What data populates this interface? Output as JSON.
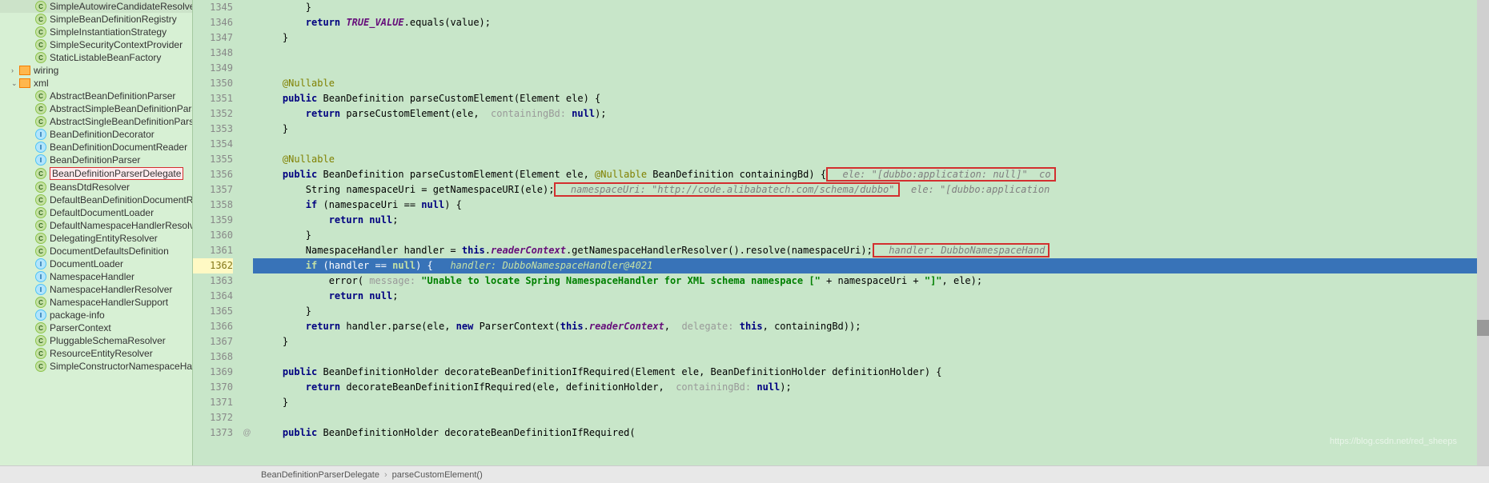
{
  "sidebar": {
    "items": [
      {
        "icon": "c",
        "label": "SimpleAutowireCandidateResolver"
      },
      {
        "icon": "c",
        "label": "SimpleBeanDefinitionRegistry"
      },
      {
        "icon": "c",
        "label": "SimpleInstantiationStrategy"
      },
      {
        "icon": "c",
        "label": "SimpleSecurityContextProvider"
      },
      {
        "icon": "c",
        "label": "StaticListableBeanFactory"
      }
    ],
    "folders": [
      {
        "expand": "›",
        "label": "wiring"
      },
      {
        "expand": "⌄",
        "label": "xml"
      }
    ],
    "xml_items": [
      {
        "icon": "c",
        "label": "AbstractBeanDefinitionParser"
      },
      {
        "icon": "c",
        "label": "AbstractSimpleBeanDefinitionParser"
      },
      {
        "icon": "c",
        "label": "AbstractSingleBeanDefinitionParser"
      },
      {
        "icon": "i",
        "label": "BeanDefinitionDecorator"
      },
      {
        "icon": "i",
        "label": "BeanDefinitionDocumentReader"
      },
      {
        "icon": "i",
        "label": "BeanDefinitionParser"
      },
      {
        "icon": "c",
        "label": "BeanDefinitionParserDelegate",
        "hl": true
      },
      {
        "icon": "c",
        "label": "BeansDtdResolver"
      },
      {
        "icon": "c",
        "label": "DefaultBeanDefinitionDocumentReade"
      },
      {
        "icon": "c",
        "label": "DefaultDocumentLoader"
      },
      {
        "icon": "c",
        "label": "DefaultNamespaceHandlerResolver"
      },
      {
        "icon": "c",
        "label": "DelegatingEntityResolver"
      },
      {
        "icon": "c",
        "label": "DocumentDefaultsDefinition"
      },
      {
        "icon": "i",
        "label": "DocumentLoader"
      },
      {
        "icon": "i",
        "label": "NamespaceHandler"
      },
      {
        "icon": "i",
        "label": "NamespaceHandlerResolver"
      },
      {
        "icon": "c",
        "label": "NamespaceHandlerSupport"
      },
      {
        "icon": "i",
        "label": "package-info"
      },
      {
        "icon": "c",
        "label": "ParserContext"
      },
      {
        "icon": "c",
        "label": "PluggableSchemaResolver"
      },
      {
        "icon": "c",
        "label": "ResourceEntityResolver"
      },
      {
        "icon": "c",
        "label": "SimpleConstructorNamespaceHandl"
      }
    ]
  },
  "gutter": {
    "lines": [
      "1345",
      "1346",
      "1347",
      "1348",
      "1349",
      "1350",
      "1351",
      "1352",
      "1353",
      "1354",
      "1355",
      "1356",
      "1357",
      "1358",
      "1359",
      "1360",
      "1361",
      "1362",
      "1363",
      "1364",
      "1365",
      "1366",
      "1367",
      "1368",
      "1369",
      "1370",
      "1371",
      "1372",
      "1373"
    ],
    "highlighted": "1362",
    "last_marker": "@"
  },
  "code": {
    "l1345": "        }",
    "l1346_a": "        ",
    "l1346_kw": "return",
    "l1346_b": " ",
    "l1346_c": "TRUE_VALUE",
    "l1346_d": ".equals(value);",
    "l1347": "    }",
    "l1348": "",
    "l1349": "    ",
    "l1350_ann": "    @Nullable",
    "l1351_a": "    ",
    "l1351_kw1": "public",
    "l1351_b": " BeanDefinition parseCustomElement(Element ele) {",
    "l1352_a": "        ",
    "l1352_kw": "return",
    "l1352_b": " parseCustomElement(ele, ",
    "l1352_hint": " containingBd: ",
    "l1352_kw2": "null",
    "l1352_c": ");",
    "l1353": "    }",
    "l1354": "",
    "l1355_ann": "    @Nullable",
    "l1356_a": "    ",
    "l1356_kw1": "public",
    "l1356_b": " BeanDefinition parseCustomElement(Element ele, ",
    "l1356_ann2": "@Nullable",
    "l1356_c": " BeanDefinition containingBd) {",
    "l1356_hint": "  ele: \"[dubbo:application: null]\"  co",
    "l1357_a": "        String namespaceUri = getNamespaceURI(ele);",
    "l1357_hint": "  namespaceUri: \"http://code.alibabatech.com/schema/dubbo\"",
    "l1357_hint2": "  ele: \"[dubbo:application",
    "l1358_a": "        ",
    "l1358_kw": "if",
    "l1358_b": " (namespaceUri == ",
    "l1358_kw2": "null",
    "l1358_c": ") {",
    "l1359_a": "            ",
    "l1359_kw": "return null",
    "l1359_b": ";",
    "l1360": "        }",
    "l1361_a": "        NamespaceHandler handler = ",
    "l1361_kw": "this",
    "l1361_b": ".",
    "l1361_f": "readerContext",
    "l1361_c": ".getNamespaceHandlerResolver().resolve(namespaceUri);",
    "l1361_hint": "  handler: DubboNamespaceHand",
    "l1362_a": "        ",
    "l1362_kw": "if",
    "l1362_b": " (handler == ",
    "l1362_kw2": "null",
    "l1362_c": ") {   ",
    "l1362_hint": "handler: DubboNamespaceHandler@4021",
    "l1363_a": "            error(",
    "l1363_hint": " message: ",
    "l1363_str": "\"Unable to locate Spring NamespaceHandler for XML schema namespace [\"",
    "l1363_b": " + namespaceUri + ",
    "l1363_str2": "\"]\"",
    "l1363_c": ", ele);",
    "l1364_a": "            ",
    "l1364_kw": "return null",
    "l1364_b": ";",
    "l1365": "        }",
    "l1366_a": "        ",
    "l1366_kw": "return",
    "l1366_b": " handler.parse(ele, ",
    "l1366_kw2": "new",
    "l1366_c": " ParserContext(",
    "l1366_kw3": "this",
    "l1366_d": ".",
    "l1366_f": "readerContext",
    "l1366_e": ", ",
    "l1366_hint": " delegate: ",
    "l1366_kw4": "this",
    "l1366_g": ", containingBd));",
    "l1367": "    }",
    "l1368": "",
    "l1369_a": "    ",
    "l1369_kw": "public",
    "l1369_b": " BeanDefinitionHolder decorateBeanDefinitionIfRequired(Element ele, BeanDefinitionHolder definitionHolder) {",
    "l1370_a": "        ",
    "l1370_kw": "return",
    "l1370_b": " decorateBeanDefinitionIfRequired(ele, definitionHolder, ",
    "l1370_hint": " containingBd: ",
    "l1370_kw2": "null",
    "l1370_c": ");",
    "l1371": "    }",
    "l1372": "",
    "l1373_a": "    ",
    "l1373_kw": "public",
    "l1373_b": " BeanDefinitionHolder decorateBeanDefinitionIfRequired("
  },
  "breadcrumb": {
    "class": "BeanDefinitionParserDelegate",
    "method": "parseCustomElement()"
  },
  "watermark": "https://blog.csdn.net/red_sheeps"
}
